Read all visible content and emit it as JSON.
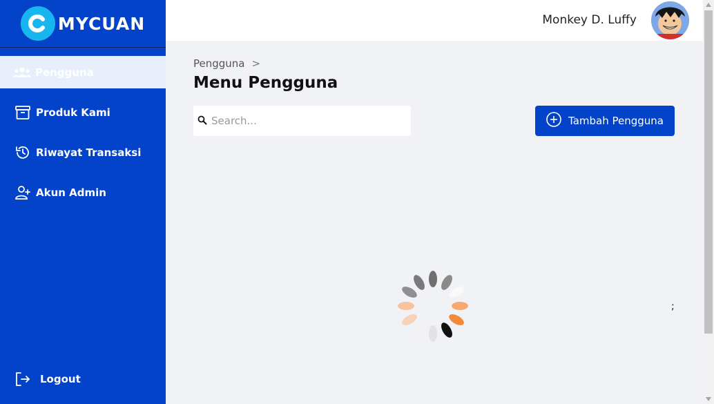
{
  "brand": {
    "name": "MYCUAN",
    "color": "#0343c9",
    "accent": "#18b6ee"
  },
  "sidebar": {
    "items": [
      {
        "label": "Pengguna",
        "icon": "users-icon",
        "active": true
      },
      {
        "label": "Produk Kami",
        "icon": "archive-box-icon",
        "active": false
      },
      {
        "label": "Riwayat Transaksi",
        "icon": "history-icon",
        "active": false
      },
      {
        "label": "Akun Admin",
        "icon": "user-plus-icon",
        "active": false
      }
    ],
    "logout_label": "Logout"
  },
  "header": {
    "user_name": "Monkey D. Luffy",
    "avatar": "user-avatar"
  },
  "main": {
    "breadcrumb": {
      "item": "Pengguna",
      "separator": ">"
    },
    "title": "Menu Pengguna",
    "search": {
      "placeholder": "Search...",
      "value": ""
    },
    "add_button_label": "Tambah Pengguna",
    "loading": true,
    "stray_text": ";"
  }
}
